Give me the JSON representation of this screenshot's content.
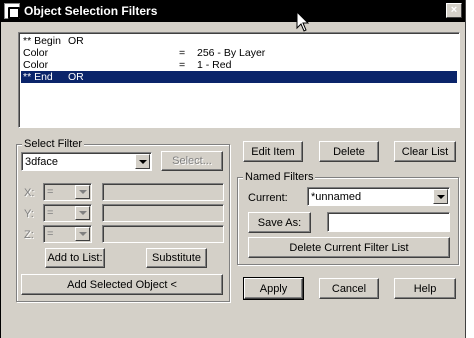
{
  "window": {
    "title": "Object Selection Filters",
    "close_glyph": "×"
  },
  "filter_list": {
    "rows": [
      {
        "c1": "** Begin",
        "c2": "OR",
        "c3": "",
        "c4": ""
      },
      {
        "c1": "Color",
        "c2": "",
        "c3": "=",
        "c4": "256 - By Layer"
      },
      {
        "c1": "Color",
        "c2": "",
        "c3": "=",
        "c4": "1 - Red"
      },
      {
        "c1": "** End",
        "c2": "OR",
        "c3": "",
        "c4": ""
      }
    ],
    "selected_index": 3
  },
  "select_filter": {
    "group_label": "Select Filter",
    "type_value": "3dface",
    "select_button": "Select...",
    "x_label": "X:",
    "y_label": "Y:",
    "z_label": "Z:",
    "operator_value": "=",
    "add_to_list_button": "Add to List:",
    "substitute_button": "Substitute",
    "add_selected_object_button": "Add Selected Object <"
  },
  "edit_buttons": {
    "edit_item": "Edit Item",
    "delete": "Delete",
    "clear_list": "Clear List"
  },
  "named_filters": {
    "group_label": "Named Filters",
    "current_label": "Current:",
    "current_value": "*unnamed",
    "save_as_button": "Save As:",
    "save_as_value": "",
    "delete_current_button": "Delete Current Filter List"
  },
  "footer": {
    "apply": "Apply",
    "cancel": "Cancel",
    "help": "Help"
  },
  "colors": {
    "title_bg": "#000000",
    "selection": "#0a246a",
    "face": "#d4d0c8"
  }
}
